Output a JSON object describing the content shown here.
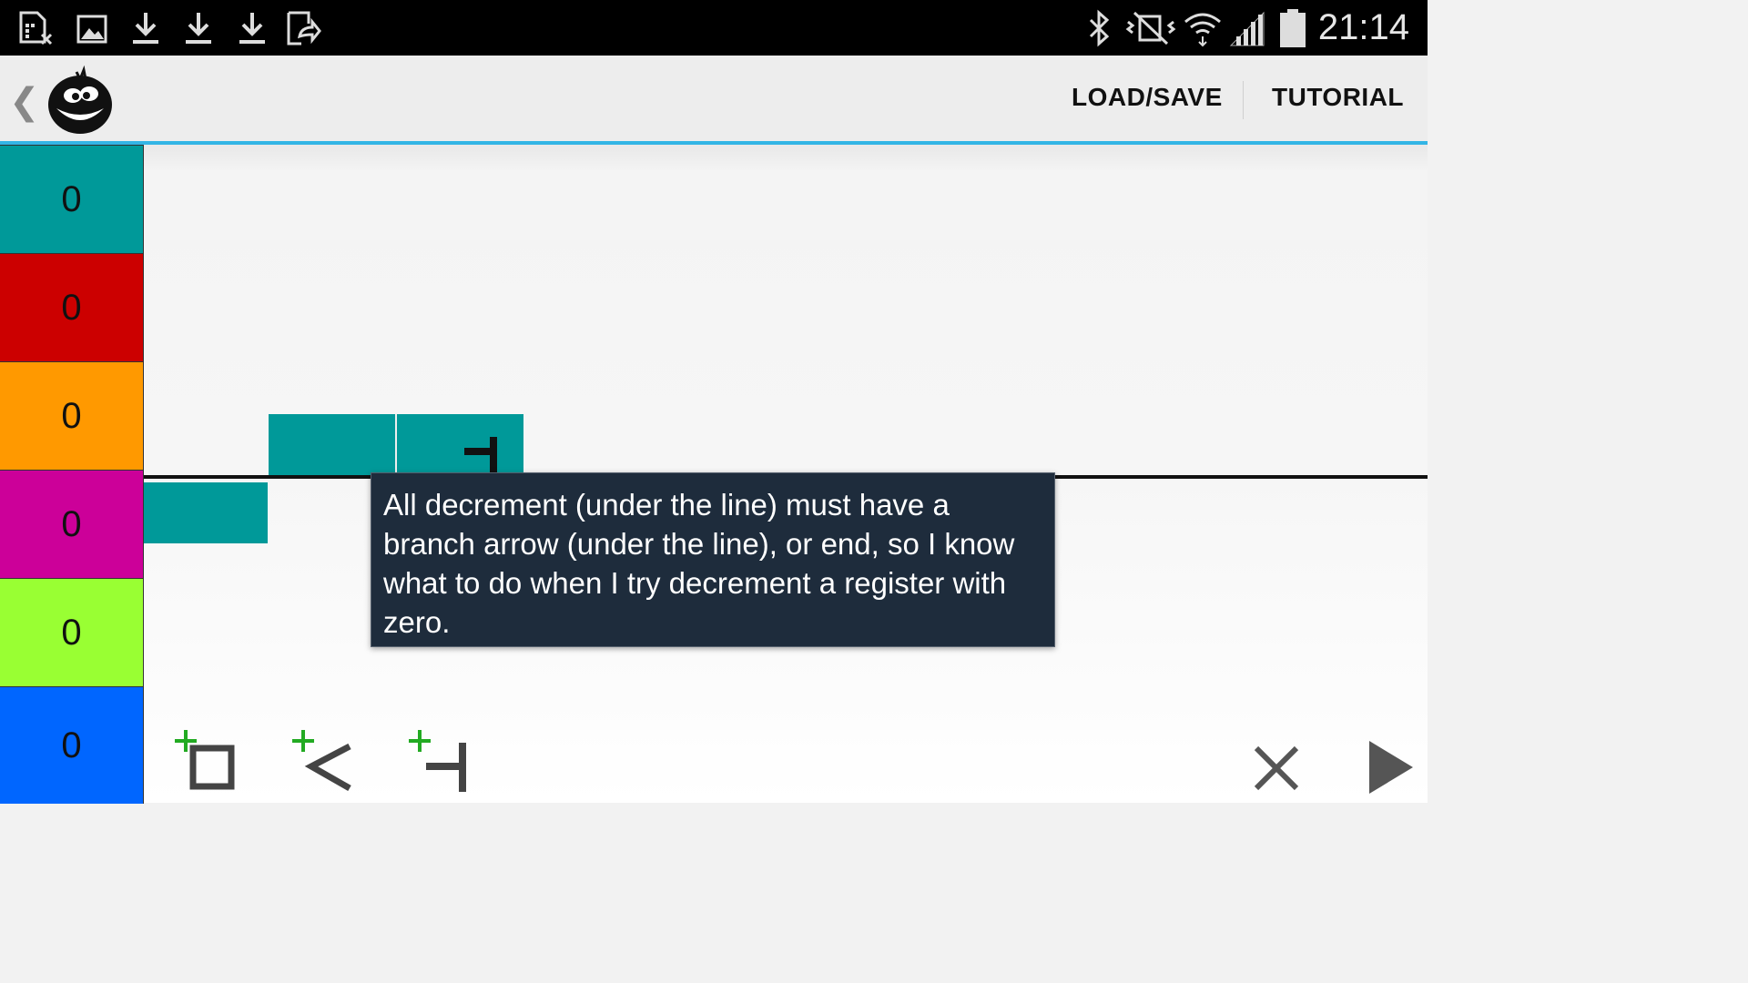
{
  "status_bar": {
    "time": "21:14",
    "notification_icons": [
      "sim-card-no-icon",
      "image-icon",
      "download-icon",
      "download-icon",
      "download-icon",
      "share-file-icon"
    ],
    "system_icons": [
      "bluetooth-icon",
      "vibrate-icon",
      "wifi-icon",
      "signal-icon",
      "battery-icon"
    ]
  },
  "action_bar": {
    "back_icon": "chevron-left-icon",
    "logo_icon": "smiley-logo-icon",
    "load_save_label": "LOAD/SAVE",
    "tutorial_label": "TUTORIAL",
    "accent_color": "#33b5e5"
  },
  "registers": [
    {
      "value": "0",
      "color": "#009999"
    },
    {
      "value": "0",
      "color": "#cc0000"
    },
    {
      "value": "0",
      "color": "#ff9900"
    },
    {
      "value": "0",
      "color": "#cc0099"
    },
    {
      "value": "0",
      "color": "#99ff33"
    },
    {
      "value": "0",
      "color": "#0066ff"
    }
  ],
  "tooltip": {
    "text": "All decrement (under the line) must have a branch arrow (under the line), or end, so I know what to do when I try decrement a register with zero."
  },
  "toolbar": {
    "add_increment_icon": "add-box-icon",
    "add_branch_icon": "add-branch-arrow-icon",
    "add_decrement_icon": "add-decrement-icon",
    "clear_icon": "close-icon",
    "run_icon": "play-icon"
  }
}
